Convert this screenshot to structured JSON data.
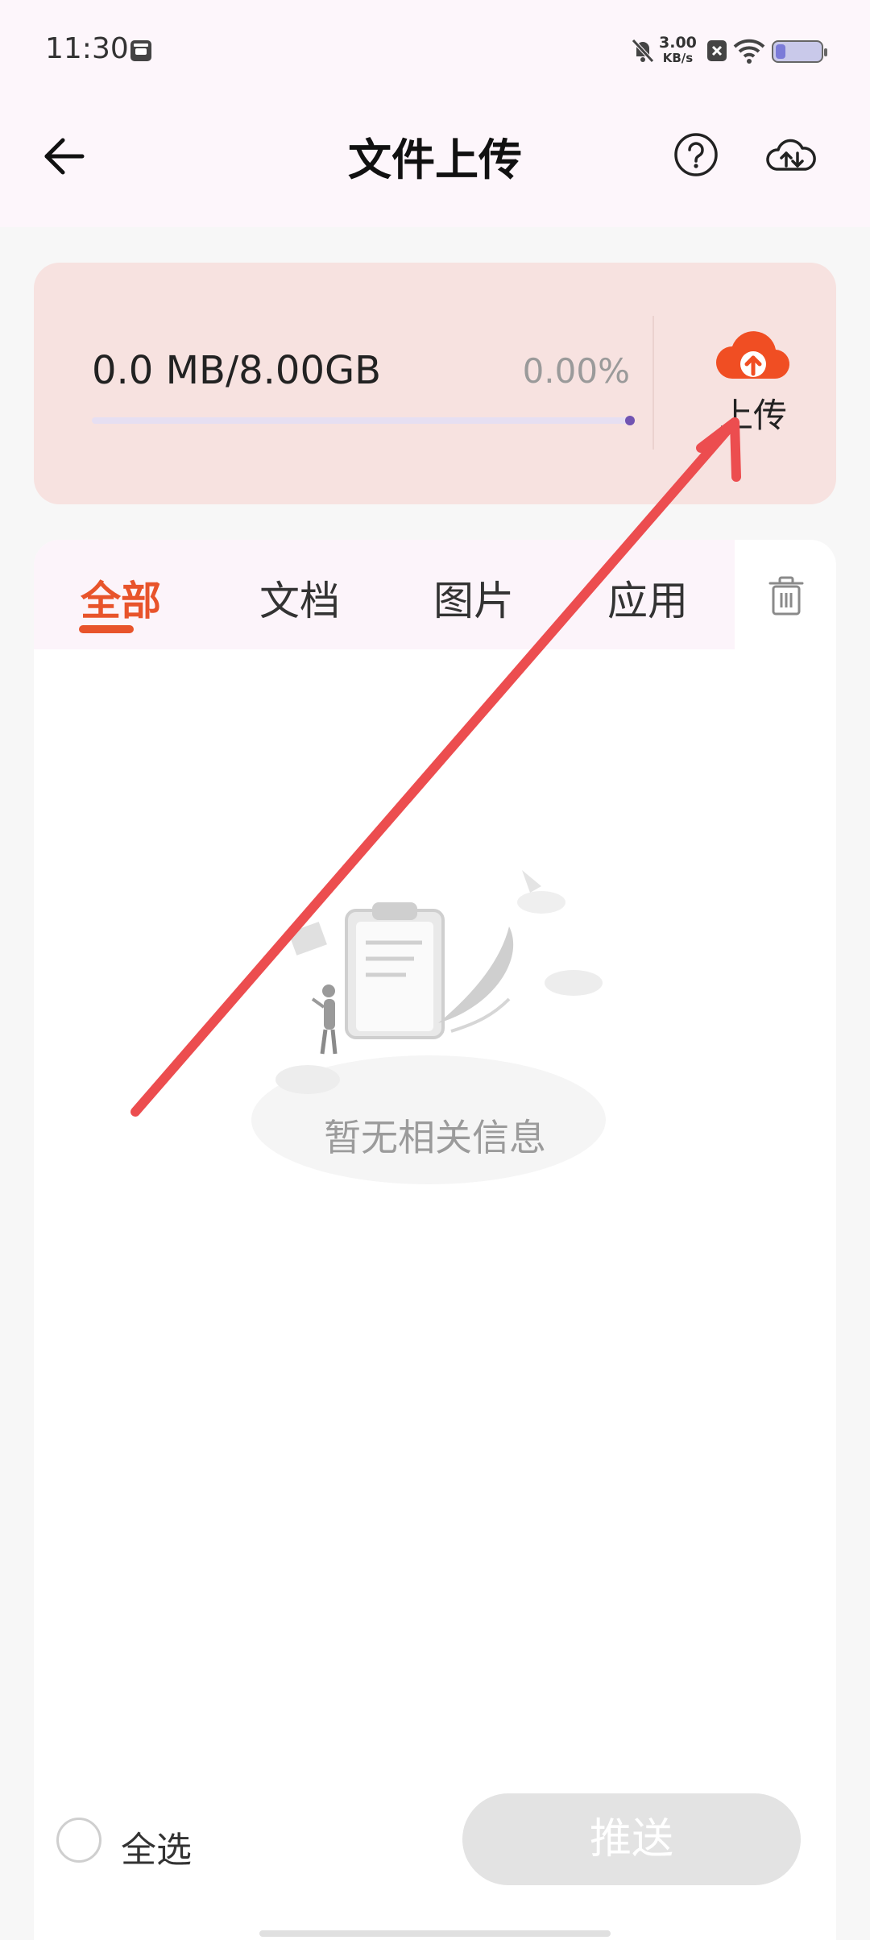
{
  "status_bar": {
    "time": "11:30",
    "net_speed_value": "3.00",
    "net_speed_unit": "KB/s",
    "battery_level": 0.22
  },
  "header": {
    "title": "文件上传"
  },
  "storage": {
    "usage_text": "0.0 MB/8.00GB",
    "percent_text": "0.00%",
    "progress": 0.0,
    "upload_label": "上传",
    "accent": "#f04e23"
  },
  "tabs": [
    {
      "label": "全部",
      "active": true
    },
    {
      "label": "文档",
      "active": false
    },
    {
      "label": "图片",
      "active": false
    },
    {
      "label": "应用",
      "active": false
    }
  ],
  "empty_state": {
    "message": "暂无相关信息"
  },
  "footer": {
    "select_all_label": "全选",
    "push_label": "推送"
  },
  "colors": {
    "active_tab": "#e8542b",
    "annotation_arrow": "#ec4d4f"
  }
}
